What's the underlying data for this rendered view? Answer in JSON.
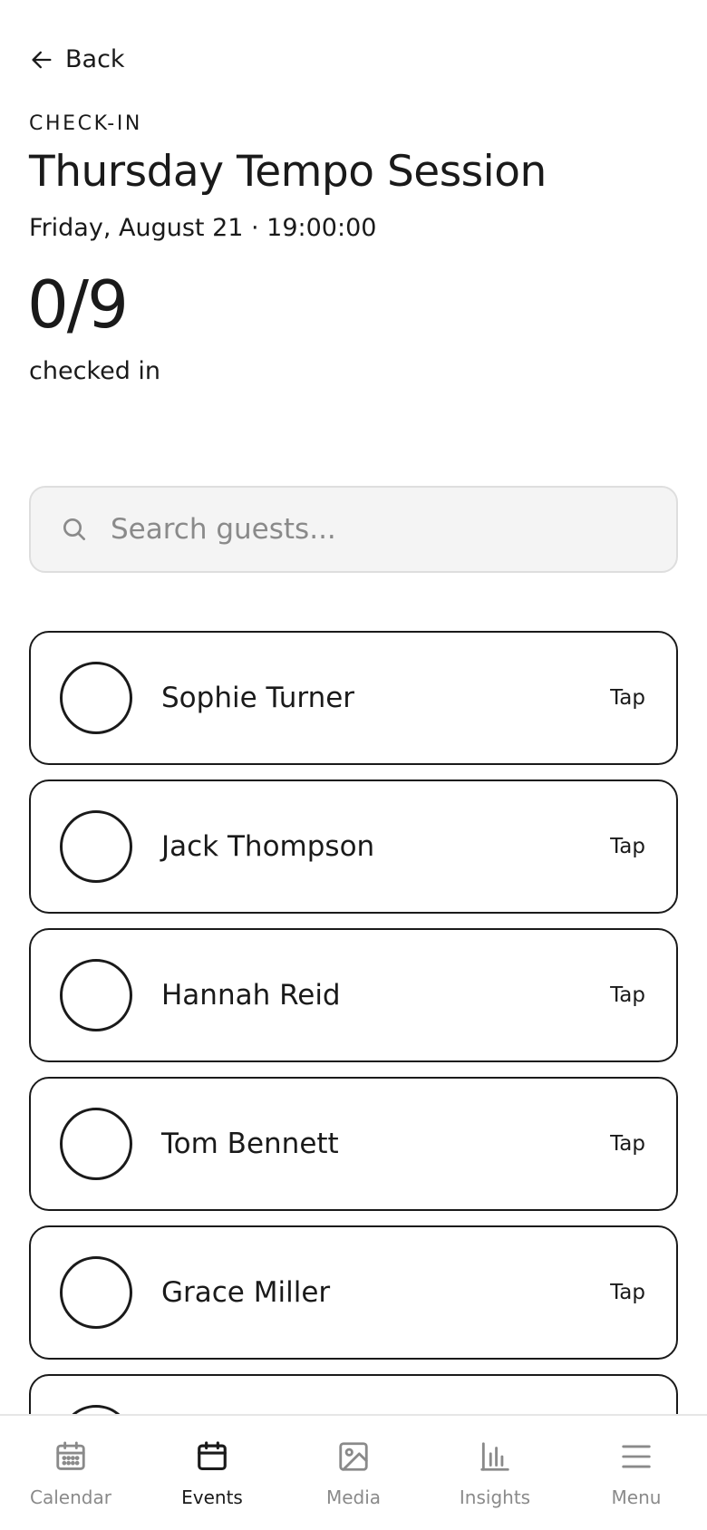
{
  "header": {
    "back_label": "Back",
    "eyebrow": "CHECK-IN",
    "title": "Thursday Tempo Session",
    "subtitle": "Friday, August 21 · 19:00:00"
  },
  "stats": {
    "count": "0/9",
    "label": "checked in"
  },
  "search": {
    "placeholder": "Search guests...",
    "value": ""
  },
  "guests": [
    {
      "name": "Sophie Turner",
      "action": "Tap"
    },
    {
      "name": "Jack Thompson",
      "action": "Tap"
    },
    {
      "name": "Hannah Reid",
      "action": "Tap"
    },
    {
      "name": "Tom Bennett",
      "action": "Tap"
    },
    {
      "name": "Grace Miller",
      "action": "Tap"
    },
    {
      "name": "",
      "action": ""
    }
  ],
  "tabbar": {
    "items": [
      {
        "label": "Calendar",
        "icon": "calendar-grid-icon"
      },
      {
        "label": "Events",
        "icon": "calendar-icon",
        "active": true
      },
      {
        "label": "Media",
        "icon": "image-icon"
      },
      {
        "label": "Insights",
        "icon": "bar-chart-icon"
      },
      {
        "label": "Menu",
        "icon": "menu-icon"
      }
    ]
  },
  "colors": {
    "text": "#1a1a1a",
    "muted": "#8a8a8a",
    "search_bg": "#f4f4f4",
    "border": "#dedede"
  }
}
